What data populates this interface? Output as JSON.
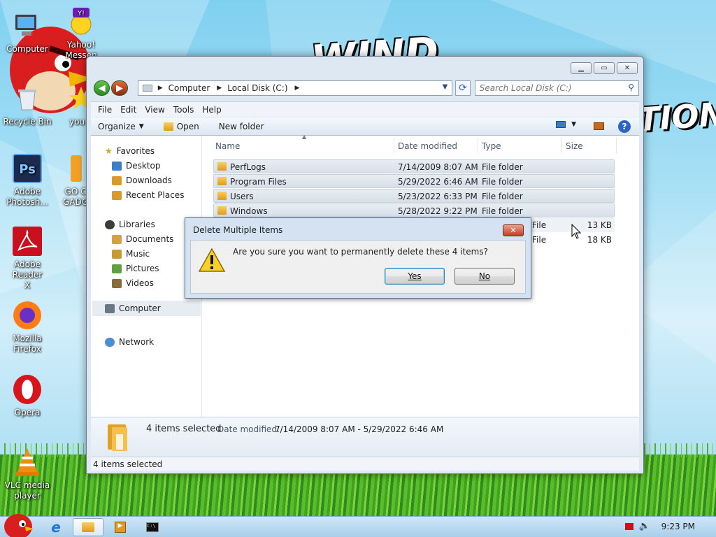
{
  "desktop": {
    "brand_text_1": "WIND",
    "brand_text_2": "TION",
    "icons": [
      {
        "label": "Computer"
      },
      {
        "label": "Yahoo!\nMessen"
      },
      {
        "label": "Recycle Bin"
      },
      {
        "label": "you ti"
      },
      {
        "label": "Adobe\nPhotosh..."
      },
      {
        "label": "GO C\nGADG"
      },
      {
        "label": "Adobe Reader\nX"
      },
      {
        "label": "Mozilla\nFirefox"
      },
      {
        "label": "Opera"
      },
      {
        "label": "VLC media\nplayer"
      }
    ]
  },
  "window": {
    "address": {
      "root": "Computer",
      "location": "Local Disk (C:)"
    },
    "search_placeholder": "Search Local Disk (C:)",
    "menu": [
      "File",
      "Edit",
      "View",
      "Tools",
      "Help"
    ],
    "toolbar": {
      "organize": "Organize",
      "open": "Open",
      "new_folder": "New folder"
    },
    "nav": {
      "favorites": "Favorites",
      "desktop": "Desktop",
      "downloads": "Downloads",
      "recent": "Recent Places",
      "libraries": "Libraries",
      "documents": "Documents",
      "music": "Music",
      "pictures": "Pictures",
      "videos": "Videos",
      "computer": "Computer",
      "network": "Network"
    },
    "columns": {
      "name": "Name",
      "date": "Date modified",
      "type": "Type",
      "size": "Size"
    },
    "files": [
      {
        "name": "PerfLogs",
        "date": "7/14/2009 8:07 AM",
        "type": "File folder",
        "size": ""
      },
      {
        "name": "Program Files",
        "date": "5/29/2022 6:46 AM",
        "type": "File folder",
        "size": ""
      },
      {
        "name": "Users",
        "date": "5/23/2022 6:33 PM",
        "type": "File folder",
        "size": ""
      },
      {
        "name": "Windows",
        "date": "5/28/2022 9:22 PM",
        "type": "File folder",
        "size": ""
      }
    ],
    "partial_rows": [
      {
        "type": "File",
        "size": "13 KB"
      },
      {
        "type": "File",
        "size": "18 KB"
      }
    ],
    "details": {
      "selected": "4 items selected",
      "date_label": "Date modified:",
      "date_range": "7/14/2009 8:07 AM - 5/29/2022 6:46 AM"
    },
    "status": "4 items selected"
  },
  "dialog": {
    "title": "Delete Multiple Items",
    "message": "Are you sure you want to permanently delete these 4 items?",
    "yes": "Yes",
    "no": "No"
  },
  "taskbar": {
    "clock": "9:23 PM"
  }
}
